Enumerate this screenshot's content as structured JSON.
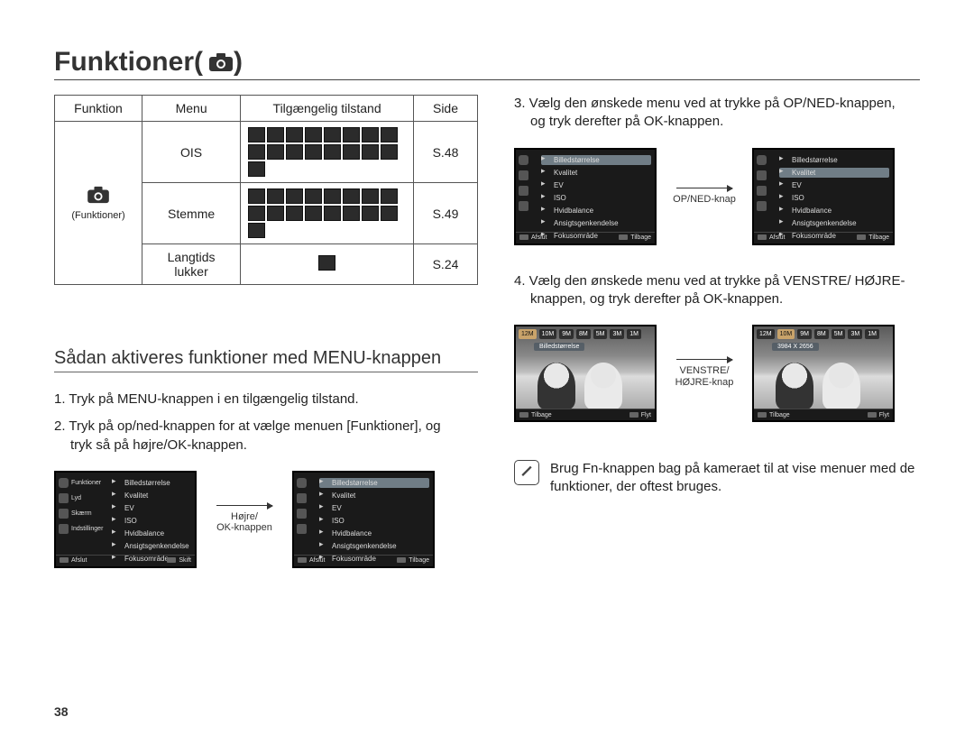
{
  "title": "Funktioner",
  "camera_icon_alt": "camera-icon",
  "page_number": "38",
  "table": {
    "headers": [
      "Funktion",
      "Menu",
      "Tilgængelig tilstand",
      "Side"
    ],
    "func_label": "(Funktioner)",
    "rows": [
      {
        "menu": "OIS",
        "side": "S.48",
        "modes": 17
      },
      {
        "menu": "Stemme",
        "side": "S.49",
        "modes": 17
      },
      {
        "menu": "Langtids lukker",
        "side": "S.24",
        "modes": 1
      }
    ]
  },
  "section_title": "Sådan aktiveres funktioner med MENU-knappen",
  "left_steps": {
    "s1": "1. Tryk på MENU-knappen i en tilgængelig tilstand.",
    "s2": "2. Tryk på op/ned-knappen for at vælge menuen [Funktioner], og",
    "s2b": "tryk så på højre/OK-knappen."
  },
  "left_arrow_caption": "Højre/\nOK-knappen",
  "right_steps": {
    "s3": "3. Vælg den ønskede menu ved at trykke på OP/NED-knappen,",
    "s3b": "og tryk derefter på OK-knappen.",
    "s4": "4. Vælg den ønskede menu ved at trykke på VENSTRE/ HØJRE-",
    "s4b": "knappen, og tryk derefter på OK-knappen."
  },
  "arrow_op_ned": "OP/NED-knap",
  "arrow_lr": "VENSTRE/\nHØJRE-knap",
  "note_text": "Brug Fn-knappen bag på kameraet til at vise menuer med de funktioner, der oftest bruges.",
  "note_glyph": "✎",
  "lcd_left_items": [
    "Funktioner",
    "Lyd",
    "Skærm",
    "Indstillinger"
  ],
  "lcd_right_items": [
    "Billedstørrelse",
    "Kvalitet",
    "EV",
    "ISO",
    "Hvidbalance",
    "Ansigtsgenkendelse",
    "Fokusområde"
  ],
  "lcd_footer_left": "Afslut",
  "lcd_footer_skift": "Skift",
  "lcd_footer_tilbage": "Tilbage",
  "lcd_photo_footer_left": "Tilbage",
  "lcd_photo_footer_right": "Flyt",
  "lcd_photo_top_chips": [
    "Billedstørrelse",
    "12M",
    "10M",
    "9M",
    "8M",
    "5M",
    "3M",
    "1M"
  ],
  "lcd_photo_top_chips_right": [
    "12M",
    "10M",
    "9M",
    "8M",
    "5M",
    "3M",
    "1M"
  ],
  "lcd_photo_resolution": "3984 X 2656"
}
